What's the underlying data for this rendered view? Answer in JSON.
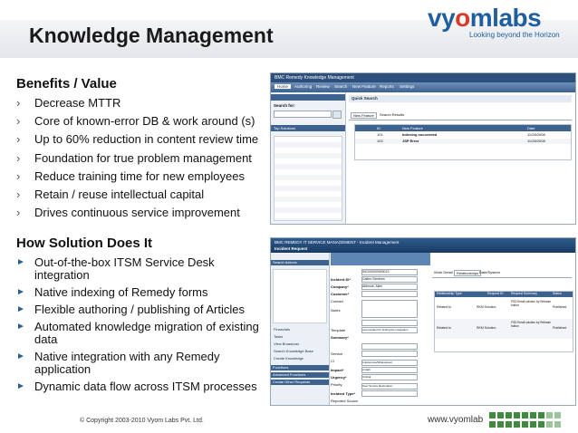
{
  "slide": {
    "title": "Knowledge Management",
    "logo": {
      "text_pre": "vy",
      "text_accent": "o",
      "text_post": "mlabs",
      "tagline": "Looking beyond the Horizon"
    },
    "benefits": {
      "heading": "Benefits / Value",
      "items": [
        "Decrease MTTR",
        "Core of known-error DB & work around (s)",
        "Up to 60% reduction in content review time",
        "Foundation for true problem management",
        "Reduce training time for new employees",
        "Retain / reuse intellectual capital",
        "Drives continuous service improvement"
      ]
    },
    "solution": {
      "heading": "How Solution Does It",
      "items": [
        "Out-of-the-box ITSM Service Desk integration",
        "Native indexing of Remedy forms",
        "Flexible authoring / publishing of Articles",
        "Automated knowledge migration of existing data",
        "Native integration with any Remedy application",
        "Dynamic data flow across ITSM processes"
      ]
    },
    "footer": {
      "copyright": "© Copyright 2003-2010 Vyom Labs Pvt. Ltd.",
      "url": "www.vyomlab"
    }
  },
  "screenshot1": {
    "app_title": "BMC Remedy Knowledge Management",
    "tabs": [
      "Home",
      "Authoring",
      "Review",
      "Search",
      "New Feature",
      "Reports",
      "Settings"
    ],
    "quick_search": "Quick Search",
    "search_for": "Search for:",
    "top_solutions": "Top Solutions",
    "sub_tabs": [
      "New Feature",
      "Search Results"
    ],
    "table_headers": [
      "ID",
      "New Feature",
      "Date"
    ],
    "rows": [
      [
        "101",
        "Indexing succeeded",
        "11/28/2008"
      ],
      [
        "102",
        "JSP Error",
        "11/28/2008"
      ]
    ]
  },
  "screenshot2": {
    "app_title": "BMC REMEDY IT SERVICE MANAGEMENT - Incident Management",
    "subtitle": "Incident Request",
    "side_items": [
      "Search Actions",
      "Financials",
      "Tasks",
      "View Broadcast",
      "Search Knowledge Base",
      "Create Knowledge",
      "Functions",
      "Advanced Functions",
      "Create Other Requests"
    ],
    "form_labels": [
      "Incident ID*",
      "Company*",
      "Customer*",
      "Contact",
      "Notes",
      "Template",
      "Summary*",
      "Service",
      "CI",
      "Impact*",
      "Urgency*",
      "Priority",
      "Incident Type*",
      "Reported Source"
    ],
    "form_values": [
      "INC000000000013",
      "Calbro Services",
      "Allbrook, Allen",
      "",
      "",
      "",
      "new incident for testing the integration",
      "",
      "",
      "1-Extensive/Widespread",
      "2-High",
      "Critical",
      "User Service Restoration",
      ""
    ],
    "rel_tabs": [
      "Work Detail",
      "Relationships",
      "Date/System"
    ],
    "rel_headers": [
      "Relationship Type",
      "Request ID",
      "Request Summary",
      "Status"
    ],
    "rel_rows": [
      [
        "Related to",
        "RKM Solution",
        "FSD Email solution by Release button",
        "Published"
      ],
      [
        "Related to",
        "RKM Solution",
        "FSD Email solution by Release button",
        "Published"
      ]
    ]
  }
}
